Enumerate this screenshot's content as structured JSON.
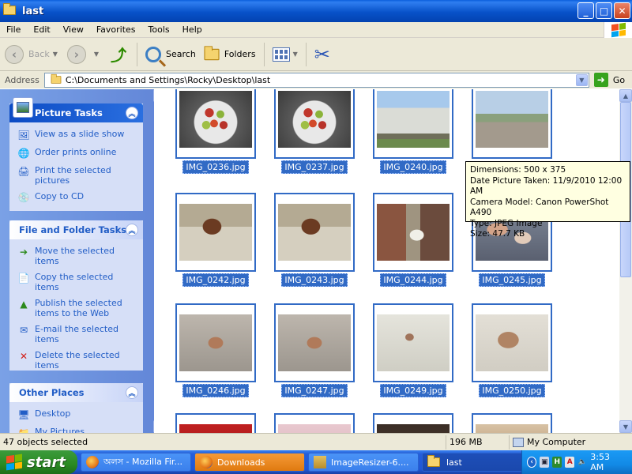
{
  "window": {
    "title": "last",
    "buttons": {
      "minimize": "_",
      "maximize": "□",
      "close": "✕"
    }
  },
  "menu": [
    "File",
    "Edit",
    "View",
    "Favorites",
    "Tools",
    "Help"
  ],
  "toolbar": {
    "back": "Back",
    "search": "Search",
    "folders": "Folders"
  },
  "address": {
    "label": "Address",
    "value": "C:\\Documents and Settings\\Rocky\\Desktop\\last",
    "go": "Go"
  },
  "taskpane": {
    "picture_tasks": {
      "title": "Picture Tasks",
      "items": [
        "View as a slide show",
        "Order prints online",
        "Print the selected pictures",
        "Copy to CD"
      ]
    },
    "file_tasks": {
      "title": "File and Folder Tasks",
      "items": [
        "Move the selected items",
        "Copy the selected items",
        "Publish the selected items to the Web",
        "E-mail the selected items",
        "Delete the selected items"
      ]
    },
    "other_places": {
      "title": "Other Places",
      "items": [
        "Desktop",
        "My Pictures"
      ]
    }
  },
  "thumbnails": [
    "IMG_0236.jpg",
    "IMG_0237.jpg",
    "IMG_0240.jpg",
    "",
    "IMG_0242.jpg",
    "IMG_0243.jpg",
    "IMG_0244.jpg",
    "IMG_0245.jpg",
    "IMG_0246.jpg",
    "IMG_0247.jpg",
    "IMG_0249.jpg",
    "IMG_0250.jpg"
  ],
  "tooltip": {
    "dimensions": "Dimensions: 500 x 375",
    "date": "Date Picture Taken: 11/9/2010 12:00 AM",
    "camera": "Camera Model: Canon PowerShot A490",
    "type": "Type: JPEG Image",
    "size": "Size: 47.7 KB"
  },
  "status": {
    "selected": "47 objects selected",
    "size": "196 MB",
    "location": "My Computer"
  },
  "taskbar": {
    "start": "start",
    "tasks": [
      "অলস - Mozilla Fir...",
      "Downloads",
      "ImageResizer-6....",
      "last"
    ],
    "clock": "3:53 AM"
  }
}
